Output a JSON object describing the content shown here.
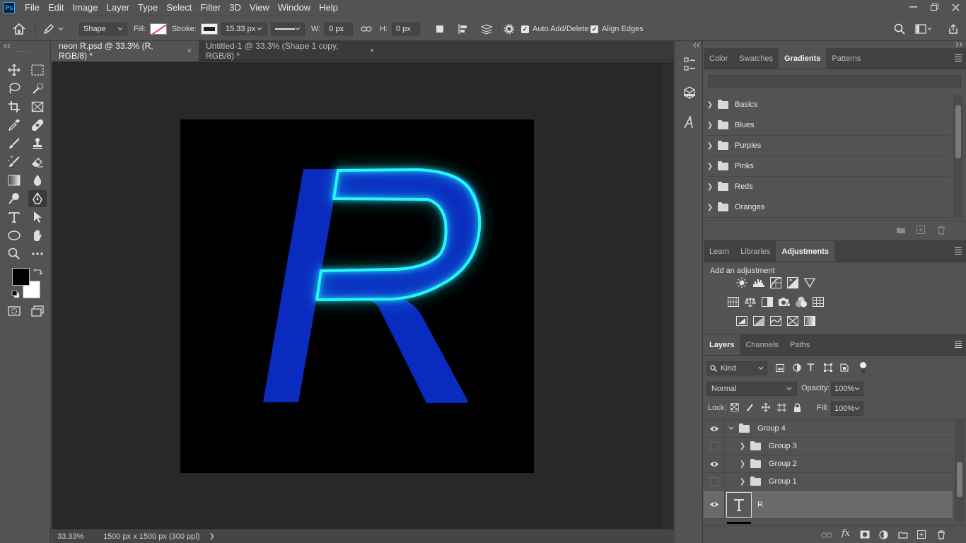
{
  "app": {
    "logo": "Ps",
    "menu": [
      "File",
      "Edit",
      "Image",
      "Layer",
      "Type",
      "Select",
      "Filter",
      "3D",
      "View",
      "Window",
      "Help"
    ]
  },
  "options_bar": {
    "mode": "Shape",
    "fill_label": "Fill:",
    "stroke_label": "Stroke:",
    "stroke_width": "15.33 px",
    "w_label": "W:",
    "w_value": "0 px",
    "h_label": "H:",
    "h_value": "0 px",
    "auto_add_delete": "Auto Add/Delete",
    "align_edges": "Align Edges"
  },
  "documents": {
    "tabs": [
      {
        "label": "neon R.psd @ 33.3% (R, RGB/8) *",
        "active": true
      },
      {
        "label": "Untitled-1 @ 33.3% (Shape 1 copy, RGB/8) *",
        "active": false
      }
    ],
    "close_glyph": "×",
    "canvas_letter": "R",
    "letter_color": "#0a2bbf",
    "neon_color": "#28f4ff"
  },
  "status": {
    "zoom": "33.33%",
    "doc_info": "1500 px x 1500 px (300 ppi)",
    "arrow": "❯"
  },
  "gradients_panel": {
    "tabs": [
      "Color",
      "Swatches",
      "Gradients",
      "Patterns"
    ],
    "active_tab": "Gradients",
    "folders": [
      "Basics",
      "Blues",
      "Purples",
      "Pinks",
      "Reds",
      "Oranges"
    ]
  },
  "adjustments_panel": {
    "tabs": [
      "Learn",
      "Libraries",
      "Adjustments"
    ],
    "active_tab": "Adjustments",
    "heading": "Add an adjustment"
  },
  "layers_panel": {
    "tabs": [
      "Layers",
      "Channels",
      "Paths"
    ],
    "active_tab": "Layers",
    "filter_kind": "Kind",
    "blend_mode": "Normal",
    "opacity_label": "Opacity:",
    "opacity_value": "100%",
    "lock_label": "Lock:",
    "fill_label": "Fill:",
    "fill_value": "100%",
    "layers": [
      {
        "name": "Group 4",
        "visible": true,
        "type": "group",
        "expanded": true,
        "indent": 0
      },
      {
        "name": "Group 3",
        "visible": false,
        "type": "group",
        "expanded": false,
        "indent": 1
      },
      {
        "name": "Group 2",
        "visible": true,
        "type": "group",
        "expanded": false,
        "indent": 1
      },
      {
        "name": "Group 1",
        "visible": false,
        "type": "group",
        "expanded": false,
        "indent": 1
      },
      {
        "name": "R",
        "visible": true,
        "type": "text",
        "selected": true
      }
    ]
  },
  "colors": {
    "foreground": "#000000",
    "background": "#ffffff",
    "ui_bg": "#535353",
    "canvas_bg": "#282828"
  }
}
